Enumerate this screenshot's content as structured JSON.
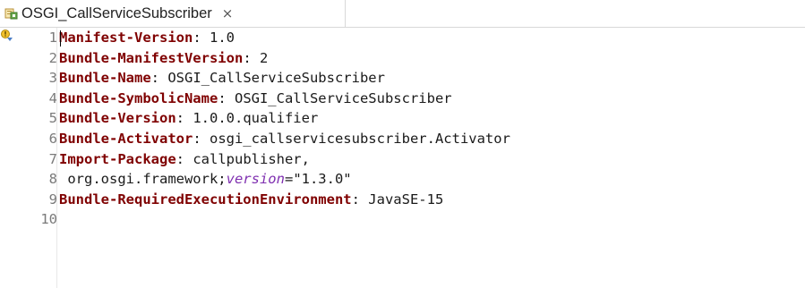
{
  "tab": {
    "title": "OSGI_CallServiceSubscriber",
    "icon": "manifest-file-icon",
    "close_glyph": "×"
  },
  "editor": {
    "line_numbers": [
      "1",
      "2",
      "3",
      "4",
      "5",
      "6",
      "7",
      "8",
      "9",
      "10"
    ],
    "lines": [
      {
        "key": "Manifest-Version",
        "sep": ": ",
        "value": "1.0"
      },
      {
        "key": "Bundle-ManifestVersion",
        "sep": ": ",
        "value": "2"
      },
      {
        "key": "Bundle-Name",
        "sep": ": ",
        "value": "OSGI_CallServiceSubscriber"
      },
      {
        "key": "Bundle-SymbolicName",
        "sep": ": ",
        "value": "OSGI_CallServiceSubscriber"
      },
      {
        "key": "Bundle-Version",
        "sep": ": ",
        "value": "1.0.0.qualifier"
      },
      {
        "key": "Bundle-Activator",
        "sep": ": ",
        "value": "osgi_callservicesubscriber.Activator"
      },
      {
        "key": "Import-Package",
        "sep": ": ",
        "value": "callpublisher,"
      },
      {
        "continuation": " org.osgi.framework;",
        "attr": "version",
        "eq": "=",
        "attr_value": "\"1.3.0\""
      },
      {
        "key": "Bundle-RequiredExecutionEnvironment",
        "sep": ": ",
        "value": "JavaSE-15"
      },
      {
        "empty": ""
      }
    ]
  },
  "colors": {
    "key": "#7f0000",
    "attribute": "#7f2fb0",
    "text": "#1a1a1a",
    "line_number": "#7a7a7a"
  }
}
